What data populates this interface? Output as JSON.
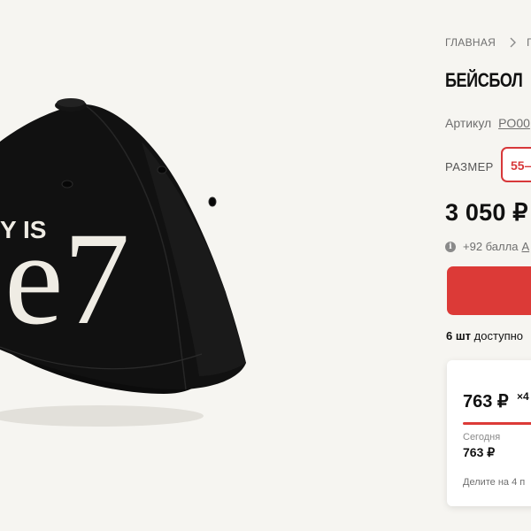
{
  "breadcrumb": {
    "home": "ГЛАВНАЯ",
    "next": "Г"
  },
  "product": {
    "title": "БЕЙСБОЛ",
    "article_label": "Артикул",
    "article_code": "PO00",
    "size_label": "РАЗМЕР",
    "size_option": "55–",
    "price": "3 050 ₽",
    "bonus_text": "+92 балла",
    "bonus_link": "А",
    "stock_count": "6 шт",
    "stock_text": "доступно",
    "image_text_small": "Y IS",
    "image_text_large": "e7",
    "accent_color": "#dc3a37"
  },
  "installment": {
    "price": "763 ₽",
    "multiplier": "×4",
    "today_label": "Сегодня",
    "today_value": "763 ₽",
    "note": "Делите на 4 п"
  }
}
